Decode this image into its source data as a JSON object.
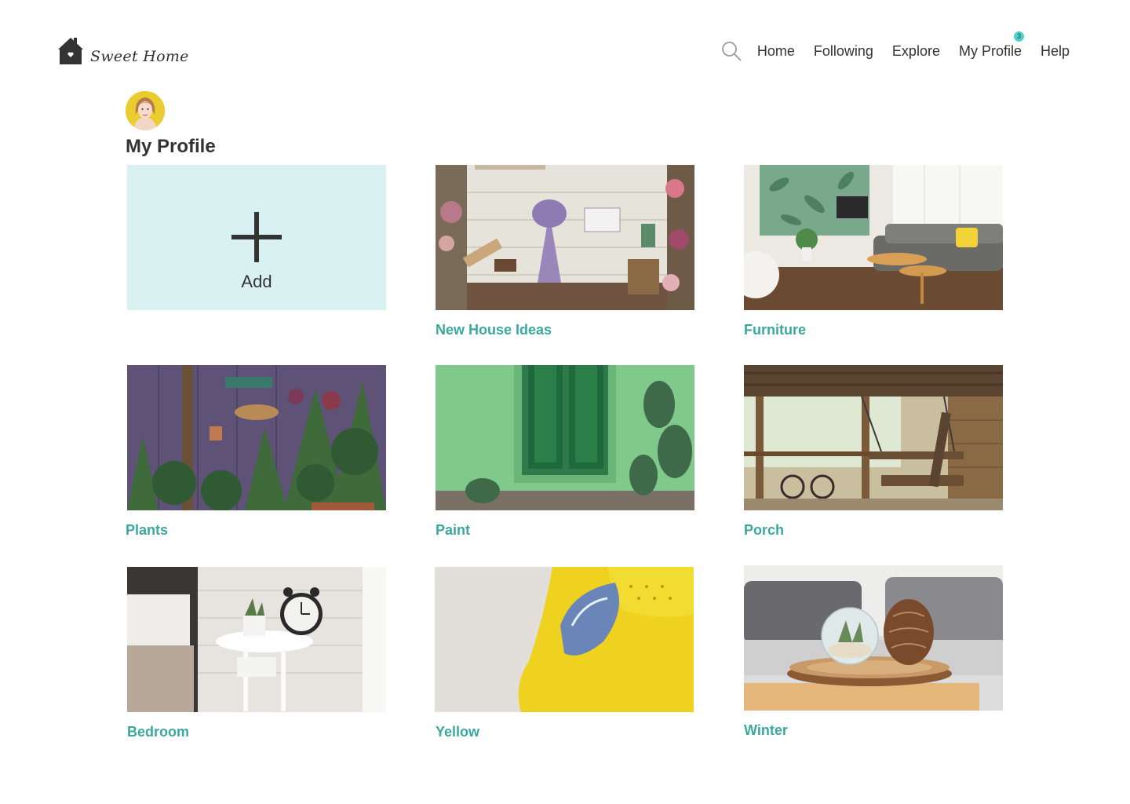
{
  "brand": {
    "name": "Sweet Home",
    "logo_icon": "house-heart-icon"
  },
  "nav": {
    "search_icon": "search-icon",
    "items": [
      {
        "label": "Home"
      },
      {
        "label": "Following"
      },
      {
        "label": "Explore"
      },
      {
        "label": "My Profile",
        "badge": "3"
      },
      {
        "label": "Help"
      }
    ]
  },
  "profile": {
    "title": "My Profile"
  },
  "add_card": {
    "label": "Add",
    "icon": "plus-icon"
  },
  "boards": [
    {
      "title": "New House Ideas"
    },
    {
      "title": "Furniture"
    },
    {
      "title": "Plants"
    },
    {
      "title": "Paint"
    },
    {
      "title": "Porch"
    },
    {
      "title": "Bedroom"
    },
    {
      "title": "Yellow"
    },
    {
      "title": "Winter"
    }
  ],
  "colors": {
    "accent": "#3aa89e",
    "badge": "#4fd1cb",
    "add_card_bg": "#d9f1f0",
    "text": "#333333"
  }
}
